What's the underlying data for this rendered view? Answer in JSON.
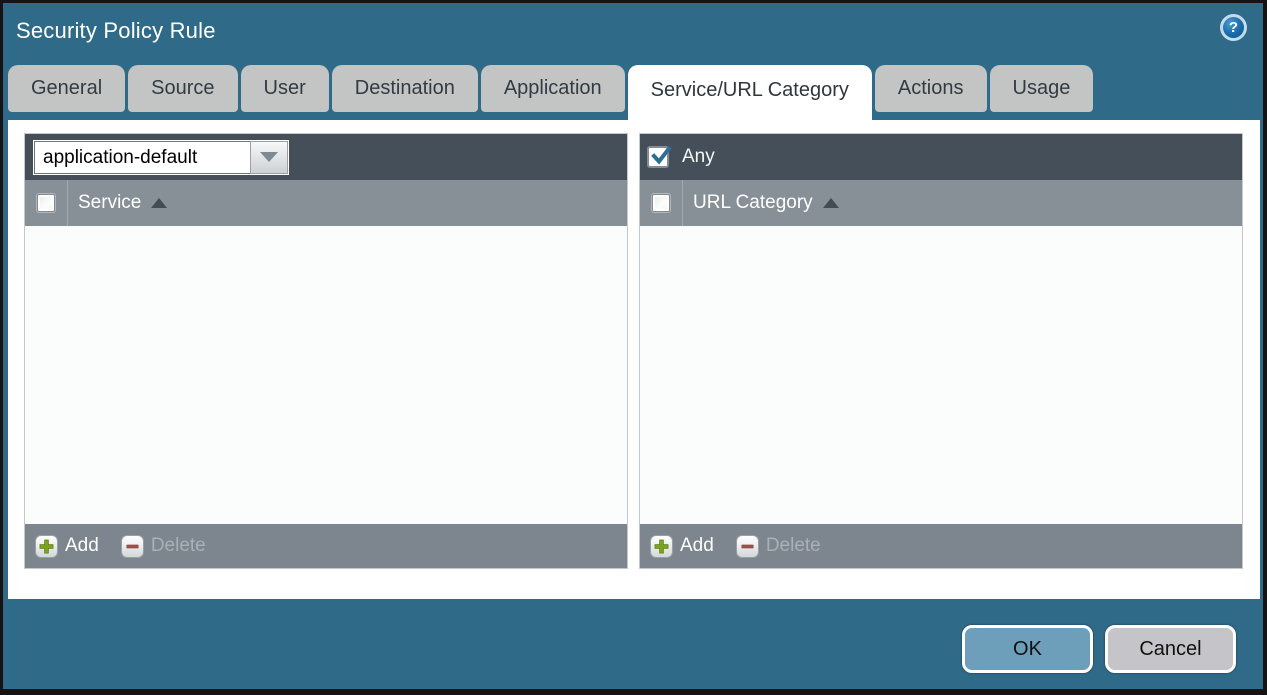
{
  "window": {
    "title": "Security Policy Rule",
    "help_glyph": "?"
  },
  "tabs": [
    {
      "label": "General",
      "active": false
    },
    {
      "label": "Source",
      "active": false
    },
    {
      "label": "User",
      "active": false
    },
    {
      "label": "Destination",
      "active": false
    },
    {
      "label": "Application",
      "active": false
    },
    {
      "label": "Service/URL Category",
      "active": true
    },
    {
      "label": "Actions",
      "active": false
    },
    {
      "label": "Usage",
      "active": false
    }
  ],
  "service_panel": {
    "dropdown": {
      "value": "application-default"
    },
    "header": {
      "column": "Service",
      "sort": "asc",
      "select_all_checked": false
    },
    "rows": [],
    "footer": {
      "add_label": "Add",
      "delete_label": "Delete",
      "delete_enabled": false
    }
  },
  "url_category_panel": {
    "any": {
      "label": "Any",
      "checked": true
    },
    "header": {
      "column": "URL Category",
      "sort": "asc",
      "select_all_checked": false
    },
    "rows": [],
    "footer": {
      "add_label": "Add",
      "delete_label": "Delete",
      "delete_enabled": false
    }
  },
  "dialog_buttons": {
    "ok_label": "OK",
    "cancel_label": "Cancel"
  },
  "icons": {
    "help": "question-mark-circle",
    "dropdown": "chevron-down",
    "sort": "triangle-up",
    "add": "green-plus",
    "delete": "red-minus",
    "any_check": "blue-checkmark"
  },
  "colors": {
    "background": "#306a89",
    "toolbar_dark": "#454f59",
    "header_gray": "#878f97",
    "footer_gray": "#7d868e",
    "list_bg": "#fafdfc",
    "tab_inactive": "#c3c4c4",
    "tab_active": "#ffffff",
    "ok_button": "#6d9eba",
    "cancel_button": "#c5c5c9",
    "add_plus_green": "#7ba31c",
    "delete_minus_red": "#9c4f44",
    "check_blue": "#2d6e92"
  }
}
